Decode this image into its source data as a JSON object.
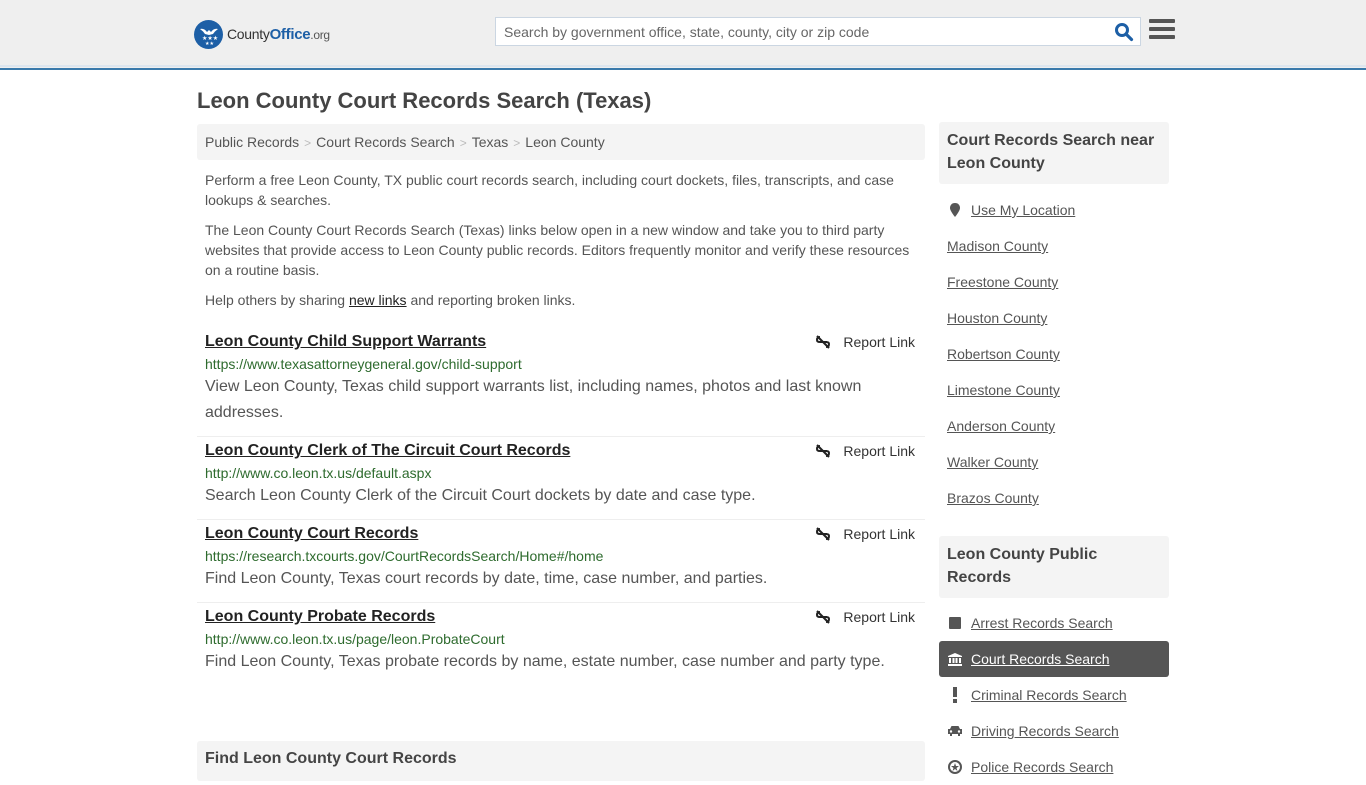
{
  "header": {
    "logo": {
      "name": "County",
      "name_bold": "Office",
      "tld": ".org"
    },
    "search_placeholder": "Search by government office, state, county, city or zip code",
    "search_value": "",
    "accent_color": "#1d5fa6",
    "border_color": "#3a7aab"
  },
  "page": {
    "title": "Leon County Court Records Search (Texas)",
    "breadcrumb": [
      "Public Records",
      "Court Records Search",
      "Texas",
      "Leon County"
    ],
    "intro": {
      "p1": "Perform a free Leon County, TX public court records search, including court dockets, files, transcripts, and case lookups & searches.",
      "p2": "The Leon County Court Records Search (Texas) links below open in a new window and take you to third party websites that provide access to Leon County public records. Editors frequently monitor and verify these resources on a routine basis.",
      "p3_before": "Help others by sharing ",
      "p3_link": "new links",
      "p3_after": " and reporting broken links."
    },
    "report_label": "Report Link",
    "results": [
      {
        "title": "Leon County Child Support Warrants",
        "url": "https://www.texasattorneygeneral.gov/child-support",
        "description": "View Leon County, Texas child support warrants list, including names, photos and last known addresses."
      },
      {
        "title": "Leon County Clerk of The Circuit Court Records",
        "url": "http://www.co.leon.tx.us/default.aspx",
        "description": "Search Leon County Clerk of the Circuit Court dockets by date and case type."
      },
      {
        "title": "Leon County Court Records",
        "url": "https://research.txcourts.gov/CourtRecordsSearch/Home#/home",
        "description": "Find Leon County, Texas court records by date, time, case number, and parties."
      },
      {
        "title": "Leon County Probate Records",
        "url": "http://www.co.leon.tx.us/page/leon.ProbateCourt",
        "description": "Find Leon County, Texas probate records by name, estate number, case number and party type."
      }
    ],
    "find_box_title": "Find Leon County Court Records"
  },
  "sidebar": {
    "nearby": {
      "title": "Court Records Search near Leon County",
      "use_location": "Use My Location",
      "counties": [
        "Madison County",
        "Freestone County",
        "Houston County",
        "Robertson County",
        "Limestone County",
        "Anderson County",
        "Walker County",
        "Brazos County"
      ]
    },
    "public_records": {
      "title": "Leon County Public Records",
      "items": [
        {
          "label": "Arrest Records Search",
          "icon": "square-icon",
          "active": false
        },
        {
          "label": "Court Records Search",
          "icon": "courthouse-icon",
          "active": true
        },
        {
          "label": "Criminal Records Search",
          "icon": "exclamation-icon",
          "active": false
        },
        {
          "label": "Driving Records Search",
          "icon": "car-icon",
          "active": false
        },
        {
          "label": "Police Records Search",
          "icon": "police-badge-icon",
          "active": false
        }
      ]
    }
  }
}
